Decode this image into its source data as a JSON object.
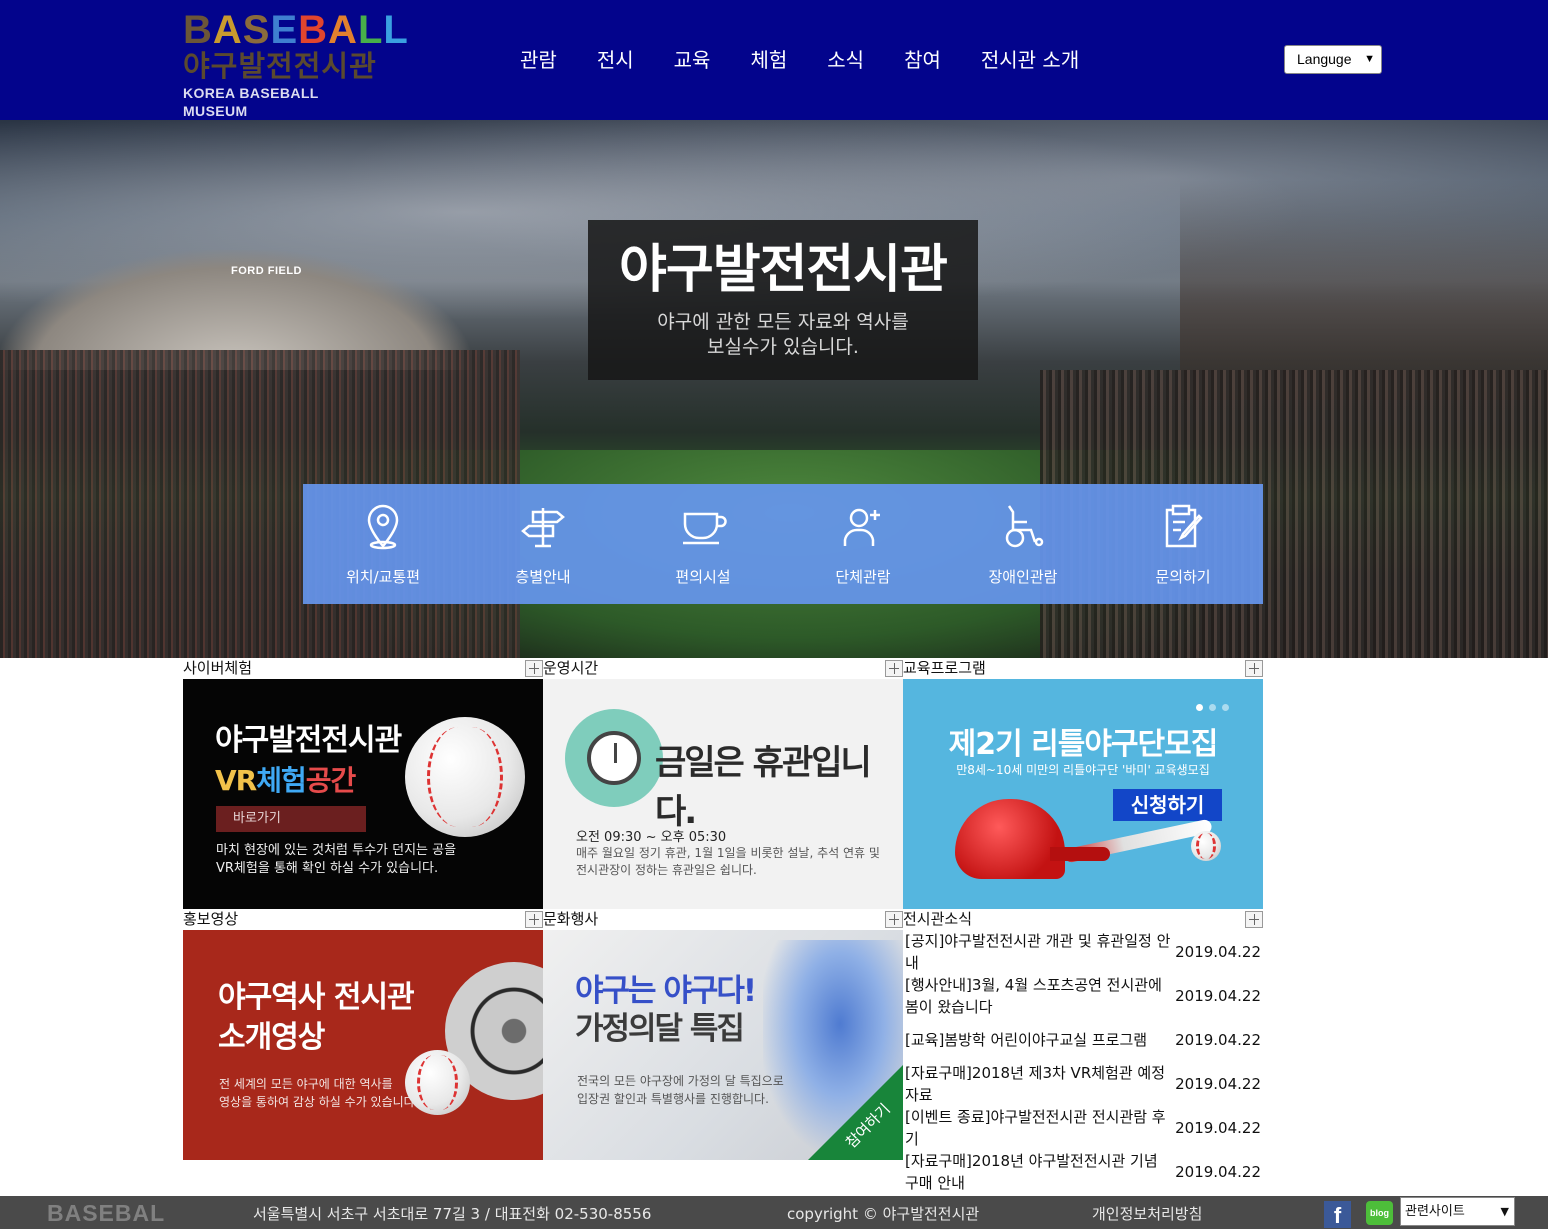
{
  "header": {
    "logo": {
      "letters": [
        "B",
        "A",
        "S",
        "E",
        "B",
        "A",
        "L",
        "L"
      ],
      "letter_colors": [
        "#6b5638",
        "#c89a2e",
        "#8a6b3c",
        "#3f7fd0",
        "#e1452e",
        "#e1802e",
        "#47b04a",
        "#3aa0e0"
      ],
      "korean": "야구발전전시관",
      "english": "KOREA BASEBALL MUSEUM"
    },
    "nav": [
      "관람",
      "전시",
      "교육",
      "체험",
      "소식",
      "참여",
      "전시관 소개"
    ],
    "language_select": "Languge"
  },
  "hero": {
    "stadium_sign": "FORD FIELD",
    "title": "야구발전전시관",
    "subtitle_line1": "야구에 관한 모든 자료와 역사를",
    "subtitle_line2": "보실수가 있습니다.",
    "quick_menu": [
      {
        "label": "위치/교통편",
        "icon": "location-pin-icon"
      },
      {
        "label": "층별안내",
        "icon": "signpost-icon"
      },
      {
        "label": "편의시설",
        "icon": "coffee-cup-icon"
      },
      {
        "label": "단체관람",
        "icon": "add-person-icon"
      },
      {
        "label": "장애인관람",
        "icon": "wheelchair-icon"
      },
      {
        "label": "문의하기",
        "icon": "clipboard-edit-icon"
      }
    ]
  },
  "sections": {
    "cyber": {
      "header": "사이버체험",
      "banner_title": "야구발전전시관",
      "banner_vr": "VR",
      "banner_exp": "체험",
      "banner_space": "공간",
      "button": "바로가기",
      "desc_line1": "마치 현장에 있는 것처럼 투수가 던지는 공을",
      "desc_line2": "VR체험을 통해 확인 하실 수가 있습니다."
    },
    "hours": {
      "header": "운영시간",
      "headline": "금일은 휴관입니다.",
      "time": "오전 09:30 ~ 오후 05:30",
      "note_line1": "매주 월요일 정기 휴관, 1월 1일을 비롯한 설날, 추석 연휴 및",
      "note_line2": "전시관장이 정하는 휴관일은 쉽니다."
    },
    "education": {
      "header": "교육프로그램",
      "headline": "제2기 리틀야구단모집",
      "sub": "만8세~10세 미만의 리틀야구단 '바미' 교육생모집",
      "button": "신청하기"
    },
    "promo": {
      "header": "홍보영상",
      "headline_line1": "야구역사 전시관",
      "headline_line2": "소개영상",
      "desc_line1": "전 세계의 모든 야구에 대한 역사를",
      "desc_line2": "영상을 통하여 감상 하실 수가 있습니다."
    },
    "culture": {
      "header": "문화행사",
      "headline_line1": "야구는 야구다!",
      "headline_line2": "가정의달 특집",
      "desc_line1": "전국의 모든 야구장에 가정의 달 특집으로",
      "desc_line2": "입장권 할인과 특별행사를 진행합니다.",
      "corner": "참여하기"
    },
    "news": {
      "header": "전시관소식",
      "items": [
        {
          "title": "[공지]야구발전전시관 개관 및 휴관일정 안내",
          "date": "2019.04.22"
        },
        {
          "title": "[행사안내]3월, 4월 스포츠공연 전시관에 봄이 왔습니다",
          "date": "2019.04.22"
        },
        {
          "title": "[교육]봄방학 어린이야구교실 프로그램",
          "date": "2019.04.22"
        },
        {
          "title": "[자료구매]2018년 제3차 VR체험관 예정자료",
          "date": "2019.04.22"
        },
        {
          "title": "[이벤트 종료]야구발전전시관 전시관람 후기",
          "date": "2019.04.22"
        },
        {
          "title": "[자료구매]2018년 야구발전전시관 기념 구매 안내",
          "date": "2019.04.22"
        }
      ]
    }
  },
  "footer": {
    "logo": "BASEBAL",
    "address": "서울특별시 서초구 서초대로 77길 3 / 대표전화 02-530-8556",
    "copyright": "copyright © 야구발전전시관",
    "privacy": "개인정보처리방침",
    "facebook": "f",
    "blog": "blog",
    "related_select": "관련사이트"
  }
}
